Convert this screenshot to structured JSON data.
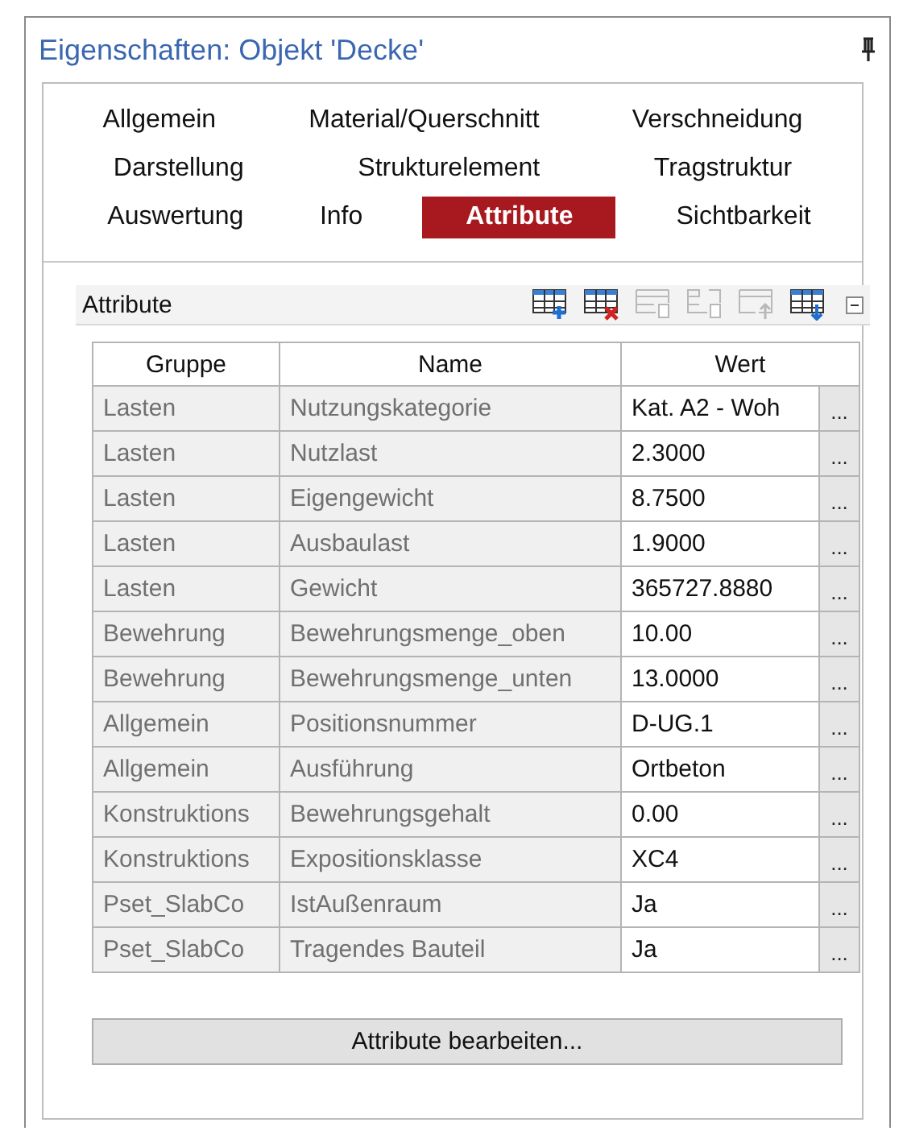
{
  "window": {
    "title": "Eigenschaften: Objekt 'Decke'"
  },
  "tab_rows": [
    {
      "tabs": [
        {
          "label": "Allgemein",
          "selected": false
        },
        {
          "label": "Material/Querschnitt",
          "selected": false
        },
        {
          "label": "Verschneidung",
          "selected": false
        }
      ]
    },
    {
      "tabs": [
        {
          "label": "Darstellung",
          "selected": false
        },
        {
          "label": "Strukturelement",
          "selected": false
        },
        {
          "label": "Tragstruktur",
          "selected": false
        }
      ]
    },
    {
      "tabs": [
        {
          "label": "Auswertung",
          "selected": false
        },
        {
          "label": "Info",
          "selected": false
        },
        {
          "label": "Attribute",
          "selected": true
        },
        {
          "label": "Sichtbarkeit",
          "selected": false
        }
      ]
    }
  ],
  "section": {
    "title": "Attribute",
    "toolbar": [
      {
        "kind": "add-row",
        "disabled": false
      },
      {
        "kind": "delete-row",
        "disabled": false
      },
      {
        "kind": "copy",
        "disabled": true
      },
      {
        "kind": "paste",
        "disabled": true
      },
      {
        "kind": "move-up",
        "disabled": true
      },
      {
        "kind": "move-down",
        "disabled": false
      }
    ],
    "table": {
      "columns": [
        "Gruppe",
        "Name",
        "Wert"
      ],
      "rows": [
        {
          "group": "Lasten",
          "name": "Nutzungskategorie",
          "value": "Kat. A2 - Woh",
          "button": "..."
        },
        {
          "group": "Lasten",
          "name": "Nutzlast",
          "value": "2.3000",
          "button": "..."
        },
        {
          "group": "Lasten",
          "name": "Eigengewicht",
          "value": "8.7500",
          "button": "..."
        },
        {
          "group": "Lasten",
          "name": "Ausbaulast",
          "value": "1.9000",
          "button": "..."
        },
        {
          "group": "Lasten",
          "name": "Gewicht",
          "value": "365727.8880",
          "button": "..."
        },
        {
          "group": "Bewehrung",
          "name": "Bewehrungsmenge_oben",
          "value": "10.00",
          "button": "..."
        },
        {
          "group": "Bewehrung",
          "name": "Bewehrungsmenge_unten",
          "value": "13.0000",
          "button": "..."
        },
        {
          "group": "Allgemein",
          "name": "Positionsnummer",
          "value": "D-UG.1",
          "button": "..."
        },
        {
          "group": "Allgemein",
          "name": "Ausführung",
          "value": "Ortbeton",
          "button": "..."
        },
        {
          "group": "Konstruktions",
          "name": "Bewehrungsgehalt",
          "value": "0.00",
          "button": "..."
        },
        {
          "group": "Konstruktions",
          "name": "Expositionsklasse",
          "value": "XC4",
          "button": "..."
        },
        {
          "group": "Pset_SlabCo",
          "name": "IstAußenraum",
          "value": "Ja",
          "button": "..."
        },
        {
          "group": "Pset_SlabCo",
          "name": "Tragendes Bauteil",
          "value": "Ja",
          "button": "..."
        }
      ]
    }
  },
  "edit_button": "Attribute bearbeiten..."
}
